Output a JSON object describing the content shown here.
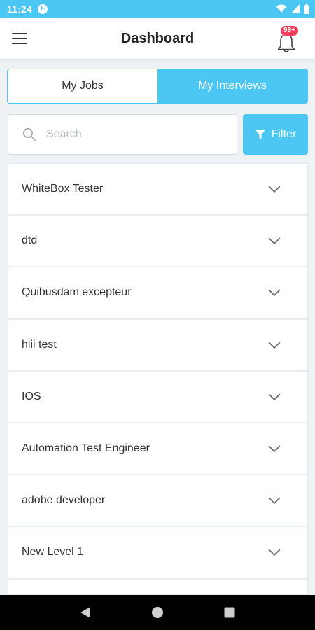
{
  "status": {
    "time": "11:24",
    "app_glyph": "F"
  },
  "header": {
    "title": "Dashboard",
    "badge": "99+",
    "icons": [
      "menu-icon",
      "bell-icon"
    ]
  },
  "tabs": [
    {
      "label": "My Jobs",
      "active": false
    },
    {
      "label": "My Interviews",
      "active": true
    }
  ],
  "search": {
    "placeholder": "Search",
    "value": ""
  },
  "filter": {
    "label": "Filter"
  },
  "jobs": [
    {
      "title": "WhiteBox Tester"
    },
    {
      "title": "dtd"
    },
    {
      "title": "Quibusdam excepteur"
    },
    {
      "title": "hiii test"
    },
    {
      "title": "IOS"
    },
    {
      "title": "Automation Test Engineer"
    },
    {
      "title": "adobe developer"
    },
    {
      "title": "New Level 1"
    }
  ],
  "colors": {
    "accent": "#4cc6f3",
    "badge": "#f2405a"
  }
}
